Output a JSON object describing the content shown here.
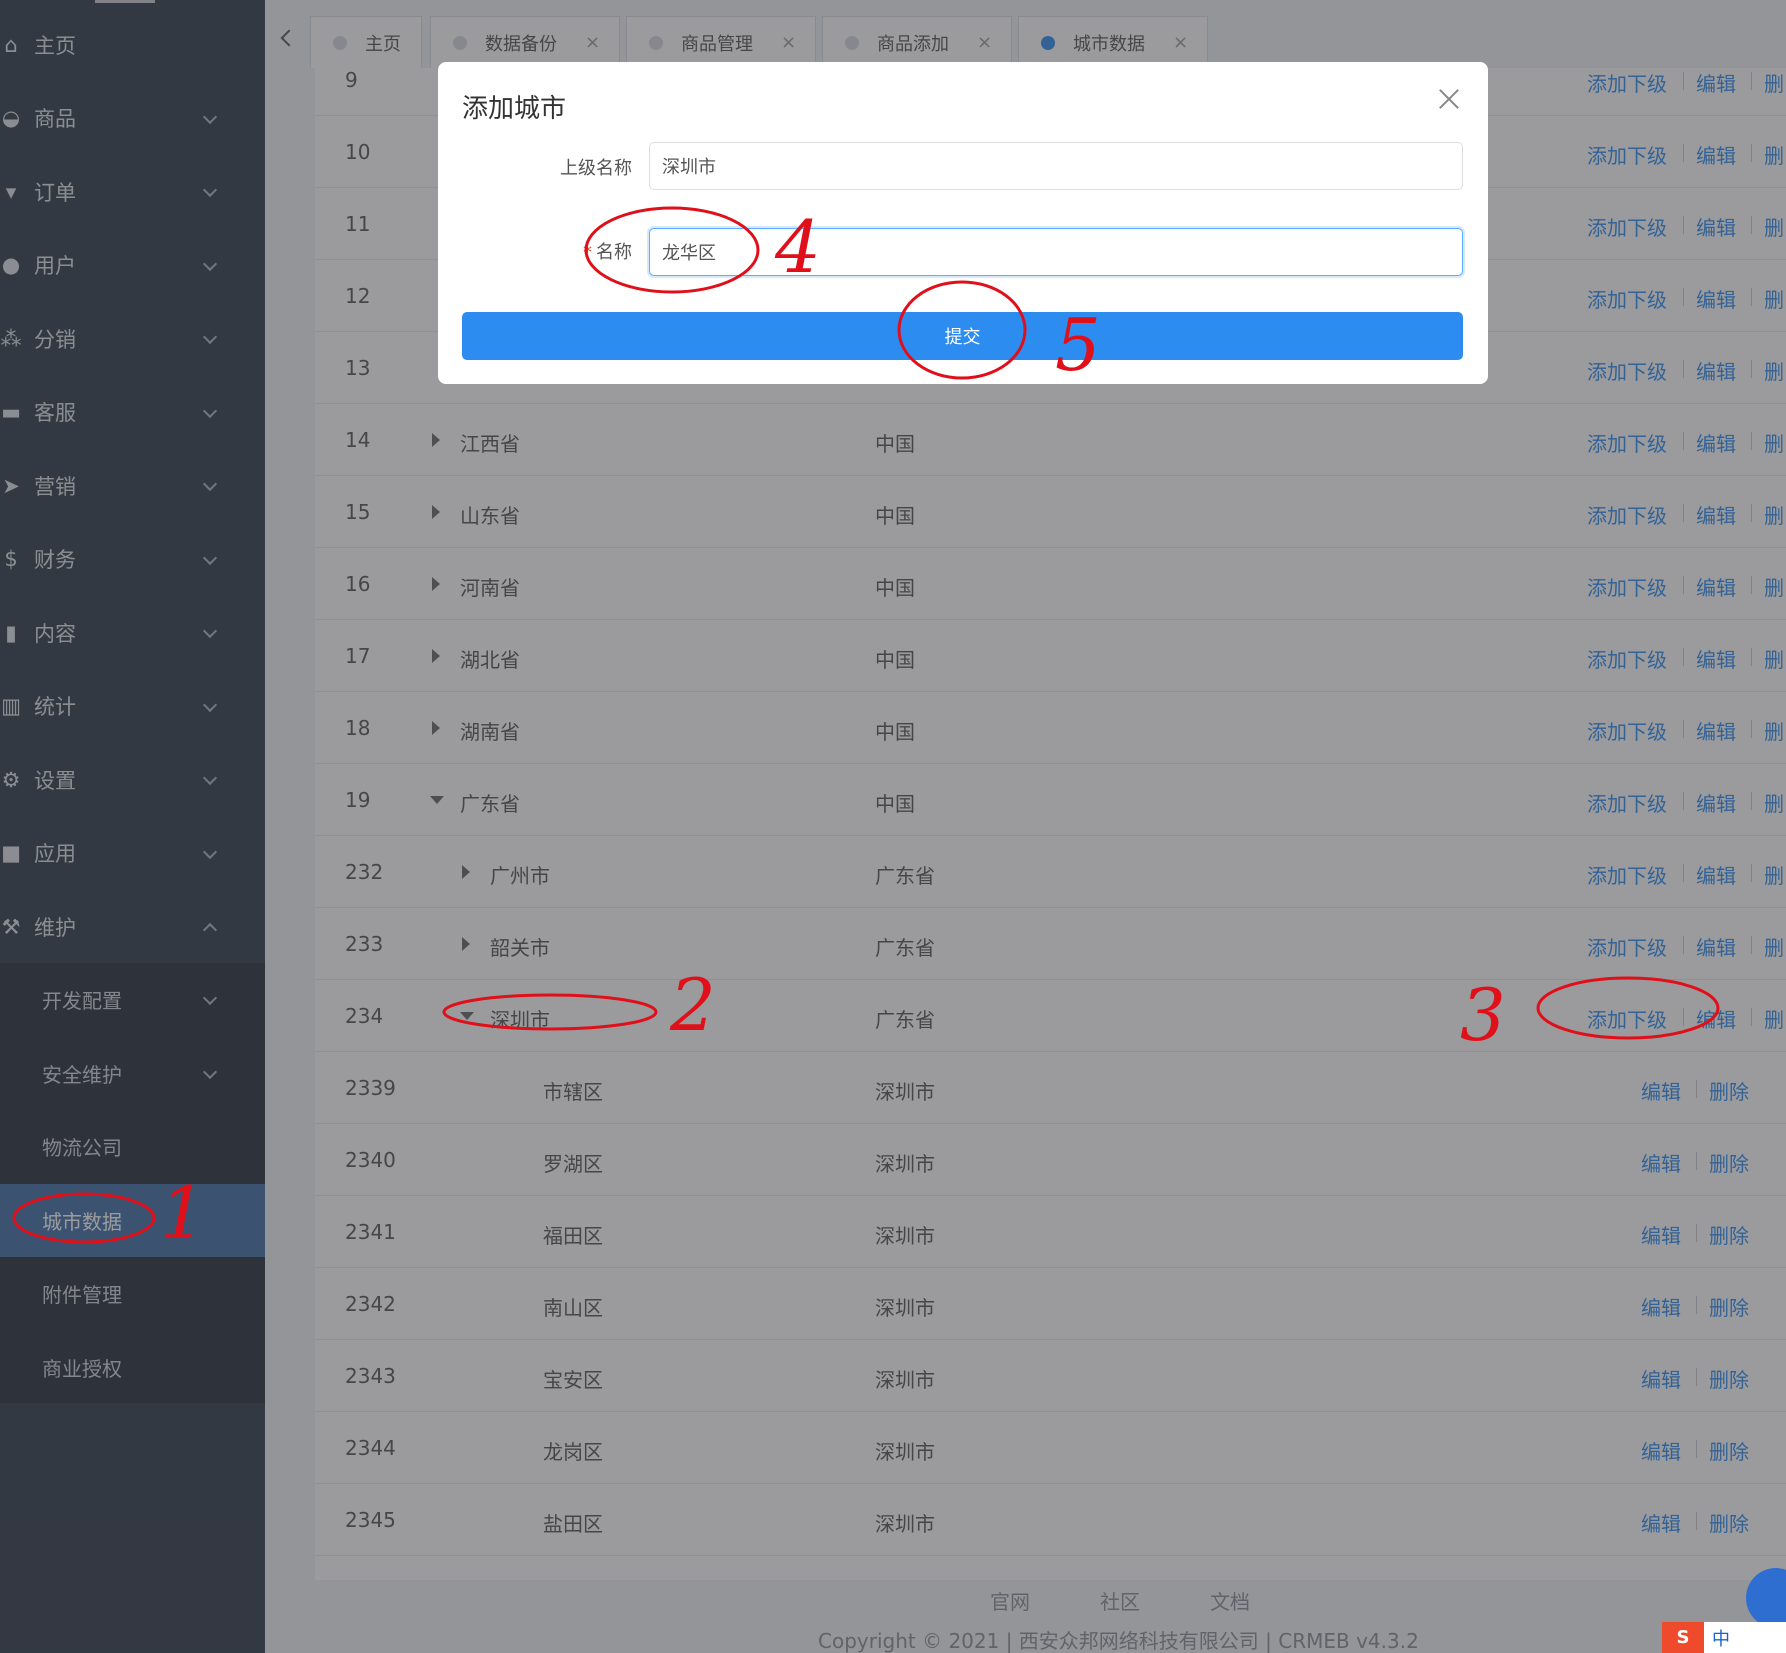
{
  "sidebar": {
    "menu": [
      {
        "label": "主页",
        "icon": "home-icon",
        "chevron": "none"
      },
      {
        "label": "商品",
        "icon": "basket-icon",
        "chevron": "down"
      },
      {
        "label": "订单",
        "icon": "cart-icon",
        "chevron": "down"
      },
      {
        "label": "用户",
        "icon": "user-icon",
        "chevron": "down"
      },
      {
        "label": "分销",
        "icon": "group-icon",
        "chevron": "down"
      },
      {
        "label": "客服",
        "icon": "chat-icon",
        "chevron": "down"
      },
      {
        "label": "营销",
        "icon": "paper-plane-icon",
        "chevron": "down"
      },
      {
        "label": "财务",
        "icon": "dollar-icon",
        "chevron": "down"
      },
      {
        "label": "内容",
        "icon": "book-icon",
        "chevron": "down"
      },
      {
        "label": "统计",
        "icon": "bar-chart-icon",
        "chevron": "down"
      },
      {
        "label": "设置",
        "icon": "gear-icon",
        "chevron": "down"
      },
      {
        "label": "应用",
        "icon": "cube-icon",
        "chevron": "down"
      },
      {
        "label": "维护",
        "icon": "hammer-icon",
        "chevron": "up"
      }
    ],
    "submenu": [
      {
        "label": "开发配置",
        "chevron": "down"
      },
      {
        "label": "安全维护",
        "chevron": "down"
      },
      {
        "label": "物流公司",
        "chevron": "none"
      },
      {
        "label": "城市数据",
        "chevron": "none",
        "active": true
      },
      {
        "label": "附件管理",
        "chevron": "none"
      },
      {
        "label": "商业授权",
        "chevron": "none"
      }
    ]
  },
  "tabs": [
    {
      "label": "主页",
      "closable": false,
      "active": false
    },
    {
      "label": "数据备份",
      "closable": true,
      "active": false
    },
    {
      "label": "商品管理",
      "closable": true,
      "active": false
    },
    {
      "label": "商品添加",
      "closable": true,
      "active": false
    },
    {
      "label": "城市数据",
      "closable": true,
      "active": true
    }
  ],
  "tab_close_glyph": "×",
  "table": {
    "actions": {
      "add_child": "添加下级",
      "edit": "编辑",
      "delete": "删",
      "delete_full": "删除"
    },
    "rows": [
      {
        "id": "9",
        "name": "",
        "parent": "",
        "level": 0,
        "arrow": "none",
        "has_add": true
      },
      {
        "id": "10",
        "name": "",
        "parent": "",
        "level": 0,
        "arrow": "none",
        "has_add": true
      },
      {
        "id": "11",
        "name": "",
        "parent": "",
        "level": 0,
        "arrow": "none",
        "has_add": true
      },
      {
        "id": "12",
        "name": "",
        "parent": "",
        "level": 0,
        "arrow": "none",
        "has_add": true
      },
      {
        "id": "13",
        "name": "",
        "parent": "",
        "level": 0,
        "arrow": "none",
        "has_add": true
      },
      {
        "id": "14",
        "name": "江西省",
        "parent": "中国",
        "level": 0,
        "arrow": "right",
        "has_add": true
      },
      {
        "id": "15",
        "name": "山东省",
        "parent": "中国",
        "level": 0,
        "arrow": "right",
        "has_add": true
      },
      {
        "id": "16",
        "name": "河南省",
        "parent": "中国",
        "level": 0,
        "arrow": "right",
        "has_add": true
      },
      {
        "id": "17",
        "name": "湖北省",
        "parent": "中国",
        "level": 0,
        "arrow": "right",
        "has_add": true
      },
      {
        "id": "18",
        "name": "湖南省",
        "parent": "中国",
        "level": 0,
        "arrow": "right",
        "has_add": true
      },
      {
        "id": "19",
        "name": "广东省",
        "parent": "中国",
        "level": 0,
        "arrow": "down",
        "has_add": true
      },
      {
        "id": "232",
        "name": "广州市",
        "parent": "广东省",
        "level": 1,
        "arrow": "right",
        "has_add": true
      },
      {
        "id": "233",
        "name": "韶关市",
        "parent": "广东省",
        "level": 1,
        "arrow": "right",
        "has_add": true
      },
      {
        "id": "234",
        "name": "深圳市",
        "parent": "广东省",
        "level": 1,
        "arrow": "down",
        "has_add": true
      },
      {
        "id": "2339",
        "name": "市辖区",
        "parent": "深圳市",
        "level": 2,
        "arrow": "none",
        "has_add": false
      },
      {
        "id": "2340",
        "name": "罗湖区",
        "parent": "深圳市",
        "level": 2,
        "arrow": "none",
        "has_add": false
      },
      {
        "id": "2341",
        "name": "福田区",
        "parent": "深圳市",
        "level": 2,
        "arrow": "none",
        "has_add": false
      },
      {
        "id": "2342",
        "name": "南山区",
        "parent": "深圳市",
        "level": 2,
        "arrow": "none",
        "has_add": false
      },
      {
        "id": "2343",
        "name": "宝安区",
        "parent": "深圳市",
        "level": 2,
        "arrow": "none",
        "has_add": false
      },
      {
        "id": "2344",
        "name": "龙岗区",
        "parent": "深圳市",
        "level": 2,
        "arrow": "none",
        "has_add": false
      },
      {
        "id": "2345",
        "name": "盐田区",
        "parent": "深圳市",
        "level": 2,
        "arrow": "none",
        "has_add": false
      }
    ]
  },
  "footer": {
    "links": [
      "官网",
      "社区",
      "文档"
    ],
    "copyright": "Copyright © 2021 | 西安众邦网络科技有限公司 | CRMEB v4.3.2"
  },
  "modal": {
    "title": "添加城市",
    "parent_label": "上级名称",
    "parent_value": "深圳市",
    "name_label": "名称",
    "required_mark": "*",
    "name_value": "龙华区",
    "submit_label": "提交"
  },
  "annotations": [
    "1",
    "2",
    "3",
    "4",
    "5"
  ],
  "ime": {
    "logo": "S",
    "mode": "中"
  },
  "colors": {
    "primary": "#2d8cf0",
    "sidebar_bg": "#2f3a4a",
    "annotation_red": "#e0101a"
  }
}
